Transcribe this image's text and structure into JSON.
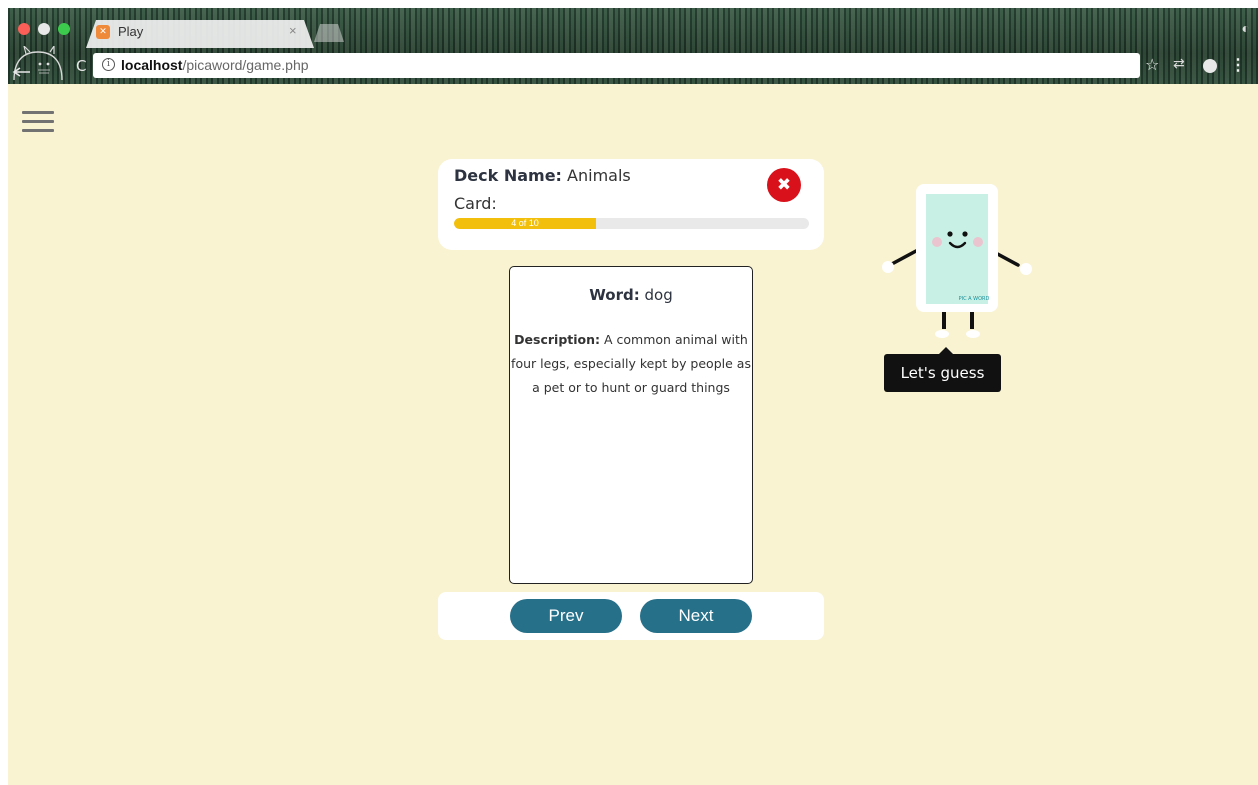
{
  "browser": {
    "tab_title": "Play",
    "tab_close": "×",
    "url_host": "localhost",
    "url_path": "/picaword/game.php",
    "reload": "C",
    "star": "☆",
    "dropbox": "⇄",
    "menu": "⋮",
    "info": "i"
  },
  "deck": {
    "name_label": "Deck Name:",
    "name": "Animals",
    "card_label": "Card:",
    "progress_text": "4 of 10",
    "progress_fraction": 0.4,
    "close_symbol": "✖"
  },
  "card": {
    "word_label": "Word:",
    "word": "dog",
    "description_label": "Description:",
    "description": "A common animal with four legs, especially kept by people as a pet or to hunt or guard things"
  },
  "nav": {
    "prev_label": "Prev",
    "next_label": "Next"
  },
  "mascot": {
    "tooltip": "Let's guess",
    "screen_logo": "PIC A WORD"
  },
  "colors": {
    "page_bg": "#f9f3d2",
    "progress": "#f2c00c",
    "close": "#d8111a",
    "button": "#27708a"
  }
}
